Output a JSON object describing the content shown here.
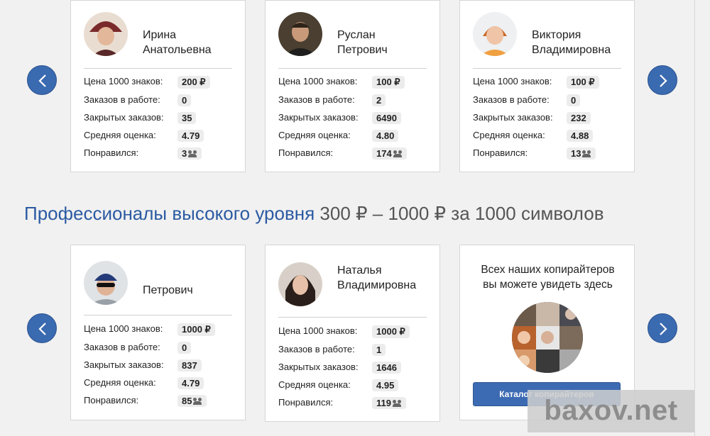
{
  "section_title": {
    "accent": "Профессионалы высокого уровня",
    "rest": " 300 ₽ – 1000 ₽ за 1000 символов"
  },
  "stat_labels": {
    "price": "Цена 1000 знаков:",
    "in_work": "Заказов в работе:",
    "closed": "Закрытых заказов:",
    "rating": "Средняя оценка:",
    "liked": "Понравился:"
  },
  "cards": [
    {
      "name1": "Ирина",
      "name2": "Анатольевна",
      "price": "200 ₽",
      "in_work": "0",
      "closed": "35",
      "rating": "4.79",
      "liked": "3"
    },
    {
      "name1": "Руслан",
      "name2": "Петрович",
      "price": "100 ₽",
      "in_work": "2",
      "closed": "6490",
      "rating": "4.80",
      "liked": "174"
    },
    {
      "name1": "Виктория",
      "name2": "Владимировна",
      "price": "100 ₽",
      "in_work": "0",
      "closed": "232",
      "rating": "4.88",
      "liked": "13"
    },
    {
      "name1": "",
      "name2": "Петрович",
      "price": "1000 ₽",
      "in_work": "0",
      "closed": "837",
      "rating": "4.79",
      "liked": "85"
    },
    {
      "name1": "Наталья",
      "name2": "Владимировна",
      "price": "1000 ₽",
      "in_work": "1",
      "closed": "1646",
      "rating": "4.95",
      "liked": "119"
    }
  ],
  "catalog": {
    "line1": "Всех наших копирайтеров",
    "line2": "вы можете увидеть здесь",
    "button": "Каталог копирайтеров"
  },
  "watermark": "baxov.net",
  "colors": {
    "accent": "#2b5aa2",
    "nav": "#3a6ab0",
    "button": "#3d6bb3"
  },
  "icons": {
    "prev": "chevron-left-icon",
    "next": "chevron-right-icon",
    "liked": "people-icon"
  }
}
